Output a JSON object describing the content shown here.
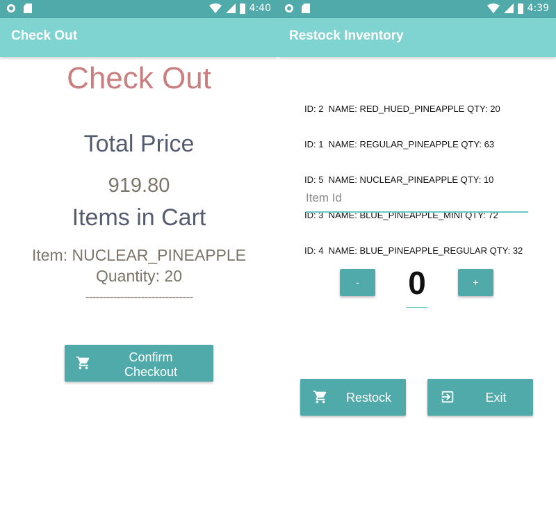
{
  "left": {
    "status_bar": {
      "time": "4:40"
    },
    "app_bar": {
      "title": "Check Out"
    },
    "heading": "Check Out",
    "total_price_label": "Total Price",
    "total_price_value": "919.80",
    "items_label": "Items in Cart",
    "cart_items": [
      {
        "item_line": "Item: NUCLEAR_PINEAPPLE",
        "quantity_line": "Quantity: 20"
      }
    ],
    "divider": "-------------------------------",
    "confirm_button": {
      "label_line1": "Confirm",
      "label_line2": "Checkout",
      "icon": "cart-icon"
    }
  },
  "right": {
    "status_bar": {
      "time": "4:39"
    },
    "app_bar": {
      "title": "Restock Inventory"
    },
    "inventory": [
      "ID: 2  NAME: RED_HUED_PINEAPPLE QTY: 20",
      "ID: 1  NAME: REGULAR_PINEAPPLE QTY: 63",
      "ID: 5  NAME: NUCLEAR_PINEAPPLE QTY: 10",
      "ID: 3  NAME: BLUE_PINEAPPLE_MINI QTY: 72",
      "ID: 4  NAME: BLUE_PINEAPPLE_REGULAR QTY: 32"
    ],
    "item_id_input": {
      "placeholder": "Item Id",
      "value": ""
    },
    "decrement_label": "-",
    "increment_label": "+",
    "quantity": "0",
    "restock_button": {
      "label": "Restock",
      "icon": "cart-icon"
    },
    "exit_button": {
      "label": "Exit",
      "icon": "exit-icon"
    }
  },
  "colors": {
    "status_bar": "#4faaa9",
    "app_bar": "#7fd3d0",
    "button": "#4faaa9",
    "heading": "#c97f7f",
    "label": "#555c6f",
    "value": "#7b756a"
  }
}
